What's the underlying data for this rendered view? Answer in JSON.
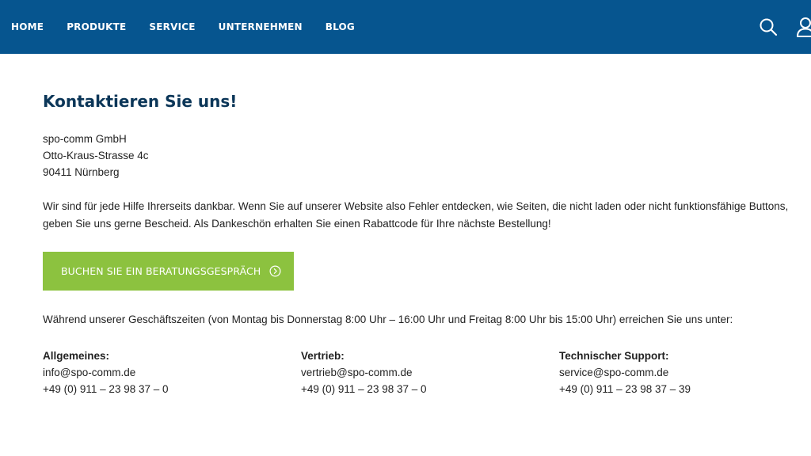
{
  "header": {
    "nav": [
      "HOME",
      "PRODUKTE",
      "SERVICE",
      "UNTERNEHMEN",
      "BLOG"
    ],
    "background_color": "#06558f",
    "icons": [
      "search-icon",
      "user-icon"
    ]
  },
  "main": {
    "title": "Kontaktieren Sie uns!",
    "address": [
      "spo-comm GmbH",
      "Otto-Kraus-Strasse 4c",
      "90411 Nürnberg"
    ],
    "intro": "Wir sind für jede Hilfe Ihrerseits dankbar. Wenn Sie auf unserer Website also Fehler entdecken, wie Seiten, die nicht laden oder nicht funktionsfähige Buttons, geben Sie uns gerne Bescheid. Als Dankeschön erhalten Sie einen Rabattcode für Ihre nächste Bestellung!",
    "cta": {
      "label": "BUCHEN SIE EIN BERATUNGSGESPRÄCH",
      "color": "#8cc23f",
      "icon": "chevron-circle-right-icon"
    },
    "hours": "Während unserer Geschäftszeiten (von Montag bis Donnerstag 8:00 Uhr – 16:00 Uhr und Freitag 8:00 Uhr bis 15:00 Uhr) erreichen Sie uns unter:",
    "contacts": [
      {
        "heading": "Allgemeines:",
        "email": "info@spo-comm.de",
        "phone": "+49 (0) 911 – 23 98 37 – 0"
      },
      {
        "heading": "Vertrieb:",
        "email": "vertrieb@spo-comm.de",
        "phone": "+49 (0) 911 – 23 98 37 – 0"
      },
      {
        "heading": "Technischer Support:",
        "email": "service@spo-comm.de",
        "phone": "+49 (0) 911 – 23 98 37 – 39"
      }
    ]
  }
}
